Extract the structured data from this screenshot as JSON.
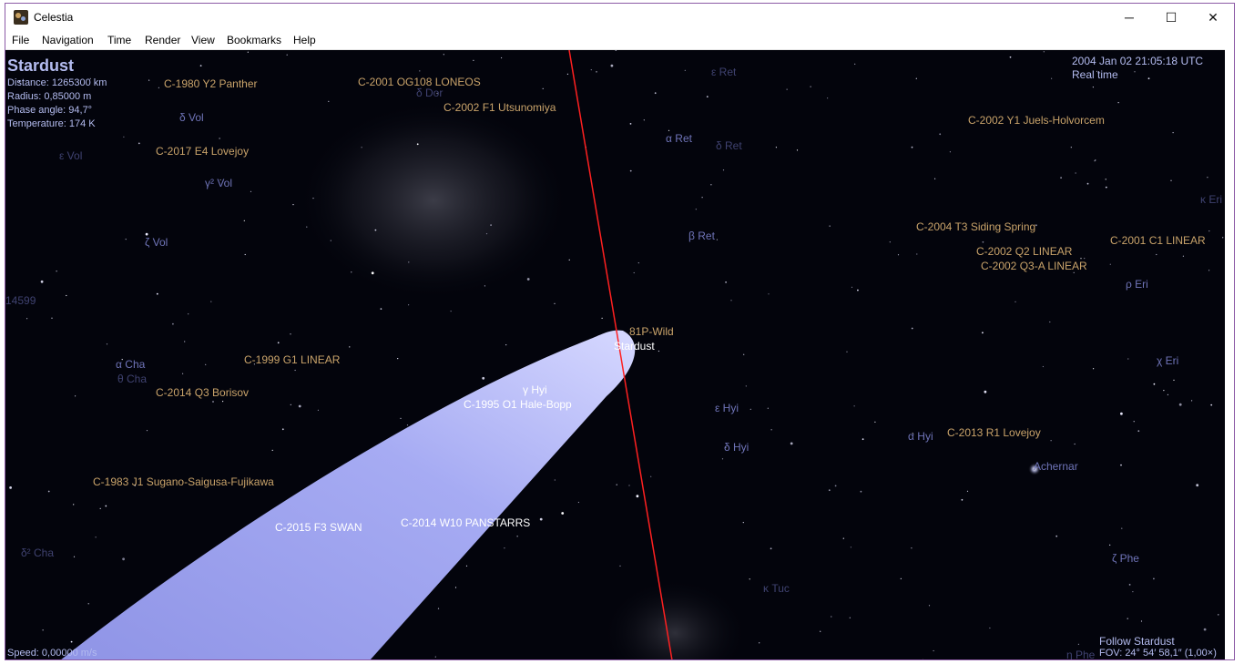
{
  "window": {
    "title": "Celestia",
    "controls": {
      "minimize": "─",
      "maximize": "☐",
      "close": "✕"
    }
  },
  "menu": [
    "File",
    "Navigation",
    "Time",
    "Render",
    "View",
    "Bookmarks",
    "Help"
  ],
  "hud": {
    "object_name": "Stardust",
    "distance": "Distance: 1265300 km",
    "radius": "Radius: 0,85000 m",
    "phase_angle": "Phase angle: 94,7°",
    "temperature": "Temperature: 174 K",
    "datetime": "2004 Jan 02 21:05:18 UTC",
    "time_mode": "Real time",
    "speed": "Speed: 0,00000 m/s",
    "follow": "Follow Stardust",
    "fov": "FOV: 24° 54′ 58,1″ (1,00×)"
  },
  "comets": [
    "C-1980 Y2 Panther",
    "C-2001 OG108 LONEOS",
    "C-2002 F1 Utsunomiya",
    "C-2017 E4 Lovejoy",
    "C-2002 Y1 Juels-Holvorcem",
    "C-2004 T3 Siding Spring",
    "C-2002 Q2 LINEAR",
    "C-2001 C1 LINEAR",
    "C-2002 Q3-A LINEAR",
    "81P-Wild",
    "C-1999 G1 LINEAR",
    "C-2014 Q3 Borisov",
    "C-1995 O1 Hale-Bopp",
    "C-2013 R1 Lovejoy",
    "C-1983 J1 Sugano-Saigusa-Fujikawa",
    "C-2015 F3 SWAN",
    "C-2014 W10 PANSTARRS"
  ],
  "spacecraft_label": "Stardust",
  "stars": [
    "δ Vol",
    "ε Vol",
    "γ² Vol",
    "ζ Vol",
    "δ Dor",
    "ε Ret",
    "α Ret",
    "δ Ret",
    "β Ret",
    "κ Eri",
    "ρ Eri",
    "χ Eri",
    "α Cha",
    "θ Cha",
    "γ Hyi",
    "ε Hyi",
    "δ Hyi",
    "α Hyi",
    "Achernar",
    "ζ Phe",
    "κ Tuc",
    "δ² Cha",
    "η Phe",
    "14599"
  ],
  "colors": {
    "space": "#03040c",
    "comet_label": "#c9a36a",
    "star_label": "#6f74b8",
    "hud_text": "#b4bcf0",
    "tail": "#a9aef5",
    "orbit": "#ff2020"
  }
}
